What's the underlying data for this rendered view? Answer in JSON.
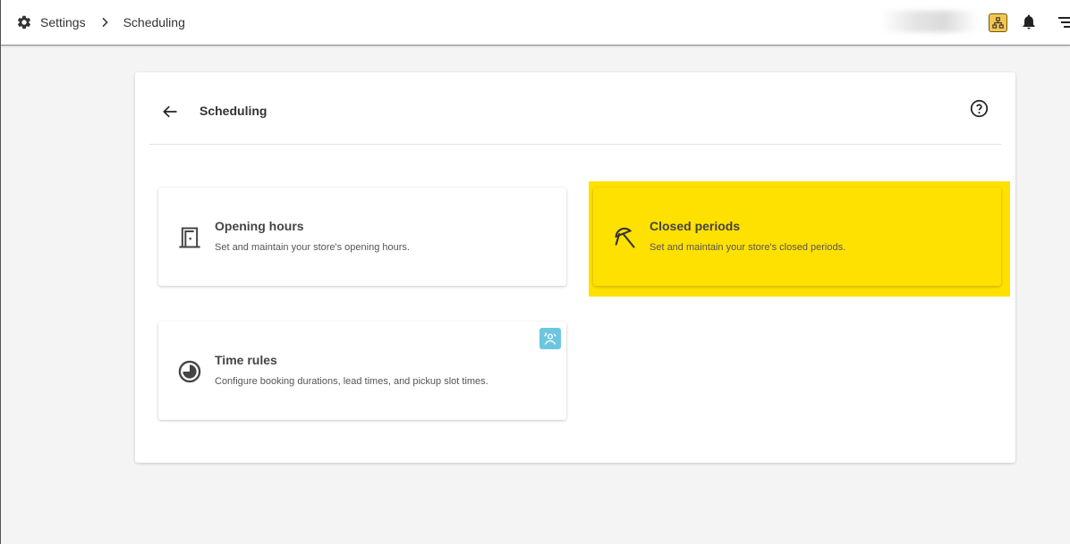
{
  "breadcrumb": {
    "icon": "gear-icon",
    "root": "Settings",
    "separator_icon": "chevron-right-icon",
    "current": "Scheduling"
  },
  "header": {
    "icons": [
      "org-chart-icon",
      "bell-icon",
      "menu-icon"
    ],
    "org_icon_color": "#f4c64e"
  },
  "page": {
    "title": "Scheduling",
    "back_icon": "arrow-left-icon",
    "help_icon": "help-circle-icon"
  },
  "cards": [
    {
      "title": "Opening hours",
      "description": "Set and maintain your store's opening hours.",
      "icon": "door-icon",
      "selected": false
    },
    {
      "title": "Closed periods",
      "description": "Set and maintain your store's closed periods.",
      "icon": "umbrella-off-icon",
      "selected": true
    },
    {
      "title": "Time rules",
      "description": "Configure booking durations, lead times, and pickup slot times.",
      "icon": "clock-progress-icon",
      "badge_icon": "feature-badge-icon",
      "selected": false
    }
  ],
  "colors": {
    "highlight": "#ffe100",
    "badge": "#6cc6e0",
    "background": "#f4f4f4",
    "panel": "#ffffff"
  }
}
